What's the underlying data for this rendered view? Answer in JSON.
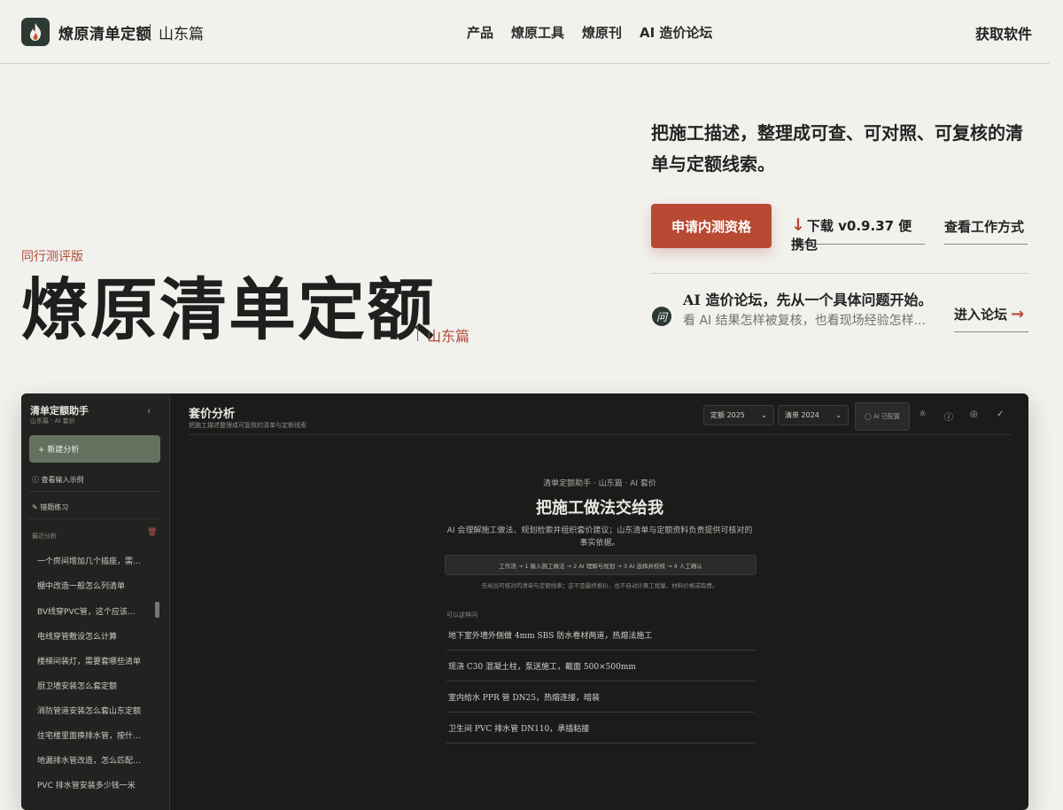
{
  "header": {
    "brand": "燎原清单定额",
    "brand_sub": "山东篇",
    "nav": [
      "产品",
      "燎原工具",
      "燎原刊",
      "AI 造价论坛"
    ],
    "cta": "获取软件"
  },
  "hero": {
    "badge": "同行测评版",
    "title": "燎原清单定额",
    "region": "山东篇",
    "tagline": "把施工描述，整理成可查、可对照、可复核的清单与定额线索。",
    "primary_button": "申请内测资格",
    "download_arrow": "↓",
    "download_label": "下载 v0.9.37 便携包",
    "how_label": "查看工作方式",
    "forum_icon": "问",
    "forum_title": "AI 造价论坛，先从一个具体问题开始。",
    "forum_sub": "看 AI 结果怎样被复核，也看现场经验怎样...",
    "forum_link": "进入论坛",
    "forum_arrow": "→"
  },
  "app": {
    "sidebar": {
      "title": "清单定额助手",
      "subtitle": "山东篇 · AI 套价",
      "collapse_icon": "‹",
      "new_button": "+ 新建分析",
      "examples_link": "ⓘ 查看输入示例",
      "practice_link": "✎ 错题练习",
      "recent_label": "最近分析",
      "trash_icon": "🗑",
      "recent": [
        "一个房间增加几个插座，需…",
        "棚中改造一般怎么列清单",
        "BV线穿PVC管，这个应该…",
        "电线穿管敷设怎么计算",
        "楼梯间装灯，需要套哪些清单",
        "厨卫墙安装怎么套定额",
        "消防管道安装怎么套山东定额",
        "住宅楼里面换排水管，按什…",
        "地漏排水管改造，怎么匹配…",
        "PVC 排水管安装多少钱一米"
      ]
    },
    "main": {
      "title": "套价分析",
      "subtitle": "把施工描述整理成可复核的清单与定额线索",
      "select_quota": "定额 2025",
      "select_list": "清单 2024",
      "select_caret": "⌄",
      "ai_config": "◯ AI 已配置",
      "tool_icons": [
        "☼",
        "ⓘ",
        "◎",
        "✓"
      ],
      "kicker": "清单定额助手 · 山东篇 · AI 套价",
      "heading": "把施工做法交给我",
      "description": "AI 会理解施工做法、规划检索并组织套价建议；山东清单与定额资料负责提供可核对的事实依据。",
      "steps": "工作流 → 1 输入施工做法 → 2 AI 理解与规划 → 3 AI 选择并校核 → 4 人工确认",
      "note": "先给出可核对的清单与定额线索；这不是最终报价，也不自动计算工程量、材料价格或取费。",
      "try_label": "可以这样问",
      "examples": [
        "地下室外墙外侧做 4mm SBS 防水卷材两道，热熔法施工",
        "现浇 C30 混凝土柱，泵送施工，截面 500×500mm",
        "室内给水 PPR 管 DN25，热熔连接，暗装",
        "卫生间 PVC 排水管 DN110，承插粘接"
      ]
    }
  }
}
